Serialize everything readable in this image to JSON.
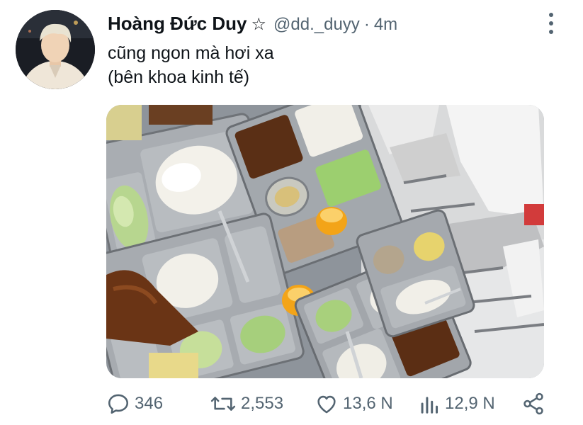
{
  "tweet": {
    "author": {
      "display_name": "Hoàng Đức Duy",
      "badge_icon": "star-outline-icon",
      "handle": "@dd._duyy",
      "separator": "·",
      "time": "4m"
    },
    "text_lines": [
      "cũng ngon mà hơi xa",
      "(bên khoa kinh tế)"
    ],
    "media": {
      "kind": "photo",
      "icon": "photo-of-food-trays"
    },
    "actions": {
      "reply_count": "346",
      "retweet_count": "2,553",
      "like_count": "13,6 N",
      "views_count": "12,9 N"
    }
  },
  "colors": {
    "text": "#0f1419",
    "secondary": "#536471",
    "background": "#ffffff"
  }
}
